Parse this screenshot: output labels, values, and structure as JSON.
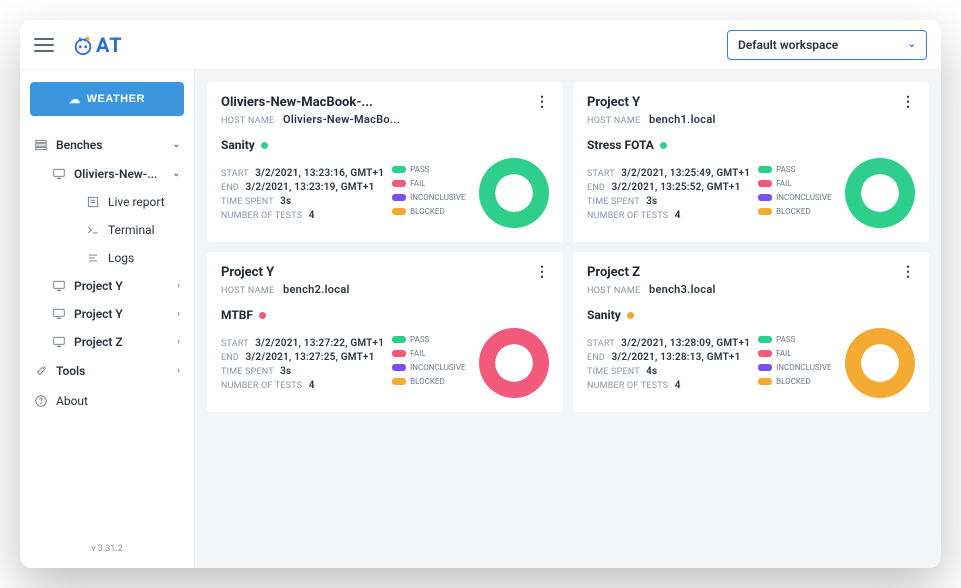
{
  "header": {
    "workspace_label": "Default workspace"
  },
  "sidebar": {
    "weather_label": "WEATHER",
    "benches_label": "Benches",
    "bench_expanded": "Oliviers-New-...",
    "live_report": "Live report",
    "terminal": "Terminal",
    "logs": "Logs",
    "projects": [
      "Project Y",
      "Project Y",
      "Project Z"
    ],
    "tools_label": "Tools",
    "about_label": "About",
    "version": "v 3.31.2"
  },
  "labels": {
    "host_name": "HOST NAME",
    "start": "START",
    "end": "END",
    "time_spent": "TIME SPENT",
    "num_tests": "NUMBER OF TESTS",
    "pass": "PASS",
    "fail": "FAIL",
    "inconclusive": "INCONCLUSIVE",
    "blocked": "BLOCKED"
  },
  "cards": [
    {
      "title": "Oliviers-New-MacBook-...",
      "host": "Oliviers-New-MacBo...",
      "suite": "Sanity",
      "status": "green",
      "start": "3/2/2021, 13:23:16, GMT+1",
      "end": "3/2/2021, 13:23:19, GMT+1",
      "time_spent": "3s",
      "num_tests": "4",
      "donut_color": "#2ecf8b"
    },
    {
      "title": "Project Y",
      "host": "bench1.local",
      "suite": "Stress FOTA",
      "status": "green",
      "start": "3/2/2021, 13:25:49, GMT+1",
      "end": "3/2/2021, 13:25:52, GMT+1",
      "time_spent": "3s",
      "num_tests": "4",
      "donut_color": "#2ecf8b"
    },
    {
      "title": "Project Y",
      "host": "bench2.local",
      "suite": "MTBF",
      "status": "pink",
      "start": "3/2/2021, 13:27:22, GMT+1",
      "end": "3/2/2021, 13:27:25, GMT+1",
      "time_spent": "3s",
      "num_tests": "4",
      "donut_color": "#f15a7a"
    },
    {
      "title": "Project Z",
      "host": "bench3.local",
      "suite": "Sanity",
      "status": "orange",
      "start": "3/2/2021, 13:28:09, GMT+1",
      "end": "3/2/2021, 13:28:13, GMT+1",
      "time_spent": "4s",
      "num_tests": "4",
      "donut_color": "#f4a933"
    }
  ]
}
